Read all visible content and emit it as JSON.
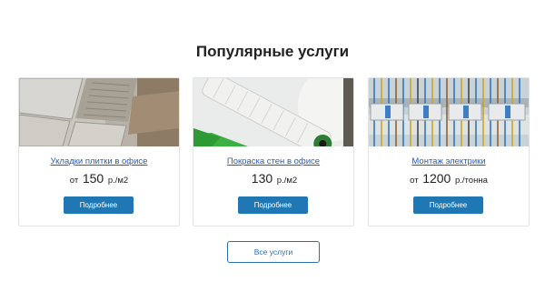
{
  "section": {
    "title": "Популярные услуги"
  },
  "cards": [
    {
      "link": "Укладки плитки в офисе",
      "price_prefix": "от",
      "price_value": "150",
      "price_unit": "р./м2",
      "button": "Подробнее"
    },
    {
      "link": "Покраска стен в офисе",
      "price_prefix": "",
      "price_value": "130",
      "price_unit": "р./м2",
      "button": "Подробнее"
    },
    {
      "link": "Монтаж электрики",
      "price_prefix": "от",
      "price_value": "1200",
      "price_unit": "р./тонна",
      "button": "Подробнее"
    }
  ],
  "all_services": {
    "label": "Все услуги"
  },
  "colors": {
    "accent": "#1f77b4",
    "link": "#2a5db0",
    "border": "#e3e3e3"
  }
}
